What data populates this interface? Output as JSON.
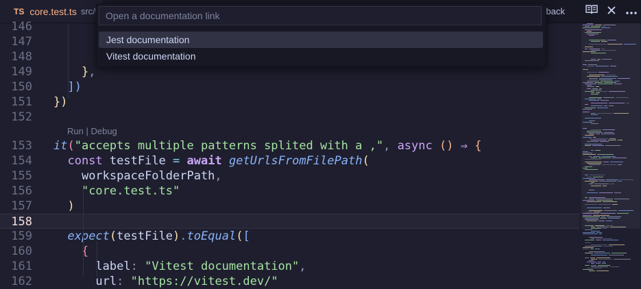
{
  "tab": {
    "icon_text": "TS",
    "icon": "typescript-icon",
    "filename": "core.test.ts",
    "path": "src/t"
  },
  "actions": {
    "partial_label": "lback",
    "icons": [
      "open-preview-icon",
      "close-icon",
      "more-actions-icon"
    ]
  },
  "quick_pick": {
    "placeholder": "Open a documentation link",
    "value": "",
    "items": [
      "Jest documentation",
      "Vitest documentation"
    ],
    "selected_index": 0
  },
  "codelens": {
    "run": "Run",
    "separator": " | ",
    "debug": "Debug"
  },
  "editor": {
    "active_line": "158",
    "lines": [
      {
        "number": "146",
        "tokens": []
      },
      {
        "number": "147",
        "tokens": []
      },
      {
        "number": "148",
        "tokens": []
      },
      {
        "number": "149",
        "tokens": [
          {
            "t": "    ",
            "c": ""
          },
          {
            "t": "}",
            "c": "b3"
          },
          {
            "t": ",",
            "c": "pun"
          }
        ]
      },
      {
        "number": "150",
        "tokens": [
          {
            "t": "  ",
            "c": ""
          },
          {
            "t": "])",
            "c": "par"
          }
        ]
      },
      {
        "number": "151",
        "tokens": [
          {
            "t": "})",
            "c": "b3"
          }
        ]
      },
      {
        "number": "152",
        "tokens": []
      },
      {
        "number": "153",
        "tokens": [
          {
            "t": "it",
            "c": "fn"
          },
          {
            "t": "(",
            "c": "b1"
          },
          {
            "t": "\"accepts multiple patterns splited with a ,\"",
            "c": "str"
          },
          {
            "t": ", ",
            "c": "pun"
          },
          {
            "t": "async",
            "c": "kw2"
          },
          {
            "t": " ",
            "c": ""
          },
          {
            "t": "()",
            "c": "b2"
          },
          {
            "t": " ⇒ ",
            "c": "kw2"
          },
          {
            "t": "{",
            "c": "b2"
          }
        ]
      },
      {
        "number": "154",
        "tokens": [
          {
            "t": "  ",
            "c": ""
          },
          {
            "t": "const",
            "c": "kw2"
          },
          {
            "t": " testFile ",
            "c": "var"
          },
          {
            "t": "=",
            "c": "op"
          },
          {
            "t": " ",
            "c": ""
          },
          {
            "t": "await",
            "c": "kw"
          },
          {
            "t": " ",
            "c": ""
          },
          {
            "t": "getUrlsFromFilePath",
            "c": "fn"
          },
          {
            "t": "(",
            "c": "b3"
          }
        ]
      },
      {
        "number": "155",
        "tokens": [
          {
            "t": "    ",
            "c": ""
          },
          {
            "t": "workspaceFolderPath",
            "c": "var"
          },
          {
            "t": ",",
            "c": "pun"
          }
        ]
      },
      {
        "number": "156",
        "tokens": [
          {
            "t": "    ",
            "c": ""
          },
          {
            "t": "\"core.test.ts\"",
            "c": "str"
          }
        ]
      },
      {
        "number": "157",
        "tokens": [
          {
            "t": "  ",
            "c": ""
          },
          {
            "t": ")",
            "c": "b3"
          }
        ]
      },
      {
        "number": "158",
        "tokens": []
      },
      {
        "number": "159",
        "tokens": [
          {
            "t": "  ",
            "c": ""
          },
          {
            "t": "expect",
            "c": "fn"
          },
          {
            "t": "(",
            "c": "b3"
          },
          {
            "t": "testFile",
            "c": "var"
          },
          {
            "t": ")",
            "c": "b3"
          },
          {
            "t": ".",
            "c": "pun"
          },
          {
            "t": "toEqual",
            "c": "fn"
          },
          {
            "t": "(",
            "c": "b3"
          },
          {
            "t": "[",
            "c": "par"
          }
        ]
      },
      {
        "number": "160",
        "tokens": [
          {
            "t": "    ",
            "c": ""
          },
          {
            "t": "{",
            "c": "b1"
          }
        ]
      },
      {
        "number": "161",
        "tokens": [
          {
            "t": "      ",
            "c": ""
          },
          {
            "t": "label",
            "c": "var"
          },
          {
            "t": ": ",
            "c": "pun"
          },
          {
            "t": "\"Vitest documentation\"",
            "c": "str"
          },
          {
            "t": ",",
            "c": "pun"
          }
        ]
      },
      {
        "number": "162",
        "tokens": [
          {
            "t": "      ",
            "c": ""
          },
          {
            "t": "url",
            "c": "var"
          },
          {
            "t": ": ",
            "c": "pun"
          },
          {
            "t": "\"https://vitest.dev/\"",
            "c": "str"
          }
        ]
      }
    ]
  }
}
